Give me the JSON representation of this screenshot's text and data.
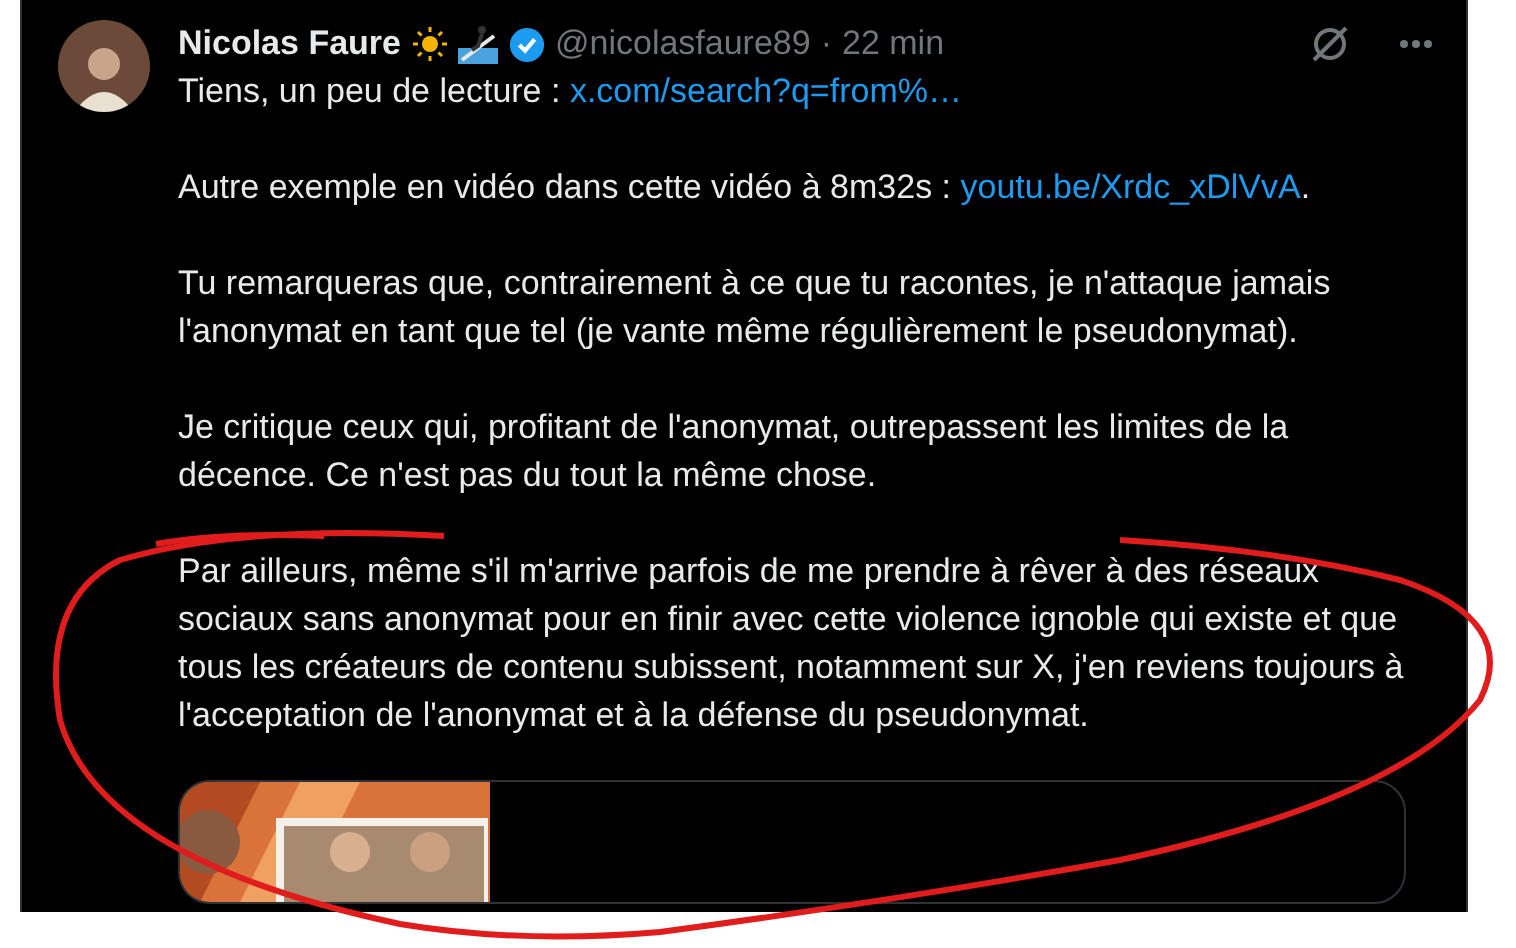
{
  "post": {
    "author": "Nicolas Faure",
    "handle": "@nicolasfaure89",
    "separator": "·",
    "time": "22 min",
    "paragraphs": [
      [
        {
          "kind": "text",
          "text": "Tiens, un peu de lecture : "
        },
        {
          "kind": "link",
          "text": "x.com/search?q=from%…"
        }
      ],
      [
        {
          "kind": "text",
          "text": "Autre exemple en vidéo dans cette vidéo à 8m32s : "
        },
        {
          "kind": "link",
          "text": "youtu.be/Xrdc_xDlVvA"
        },
        {
          "kind": "text",
          "text": "."
        }
      ],
      [
        {
          "kind": "text",
          "text": "Tu remarqueras que, contrairement à ce que tu racontes, je n'attaque jamais l'anonymat en tant que tel (je vante même régulièrement le pseudonymat)."
        }
      ],
      [
        {
          "kind": "text",
          "text": "Je critique ceux qui, profitant de l'anonymat, outrepassent les limites de la décence. Ce n'est pas du tout la même chose."
        }
      ],
      [
        {
          "kind": "text",
          "text": "Par ailleurs, même s'il m'arrive parfois de me prendre à rêver à des réseaux sociaux sans anonymat pour en finir avec cette violence ignoble qui existe et que tous les créateurs de contenu subissent, notamment sur X, j'en reviens toujours à l'acceptation de l'anonymat et à la défense du pseudonymat."
        }
      ]
    ],
    "link_card": {
      "kind": "picture"
    }
  }
}
